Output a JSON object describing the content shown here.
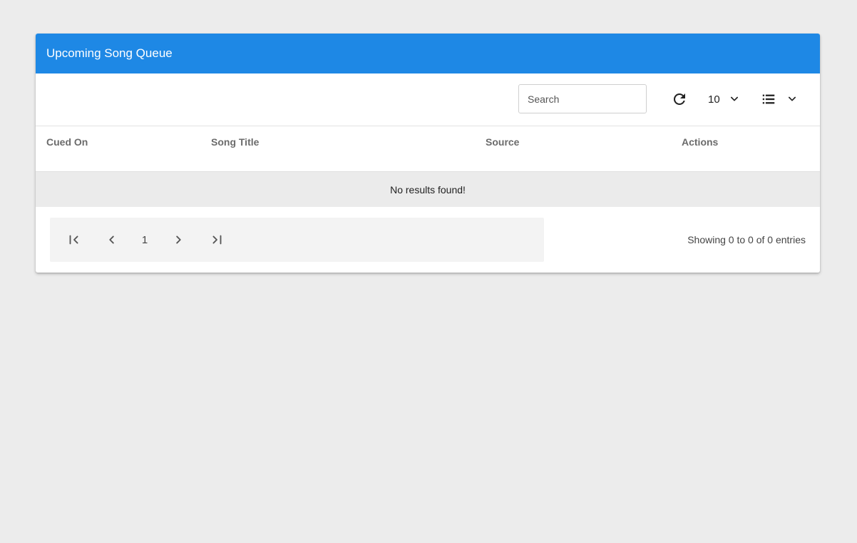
{
  "header": {
    "title": "Upcoming Song Queue"
  },
  "toolbar": {
    "search_placeholder": "Search",
    "page_size": "10",
    "refresh_icon": "refresh-icon",
    "columns_icon": "list-icon"
  },
  "table": {
    "columns": [
      "Cued On",
      "Song Title",
      "Source",
      "Actions"
    ],
    "empty_message": "No results found!"
  },
  "pagination": {
    "current_page": "1",
    "summary": "Showing 0 to 0 of 0 entries"
  },
  "colors": {
    "header_bg": "#1e88e5",
    "page_bg": "#ececec",
    "empty_row_bg": "#ebebeb"
  }
}
